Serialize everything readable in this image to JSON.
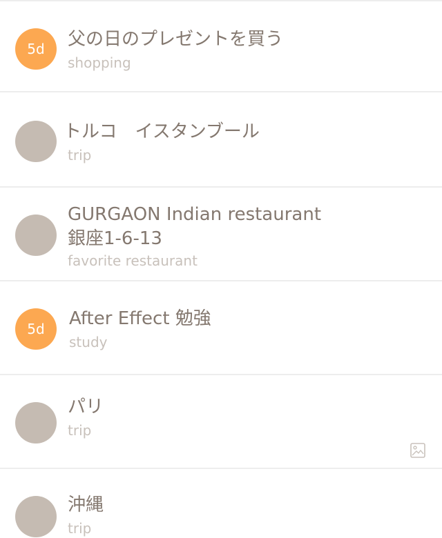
{
  "items": [
    {
      "badge": "5d",
      "title": "父の日のプレゼントを買う",
      "subtitle": "shopping"
    },
    {
      "badge": "",
      "title": "トルコ　イスタンブール",
      "subtitle": "trip"
    },
    {
      "badge": "",
      "title": "GURGAON Indian restaurant",
      "title_line2": "銀座1-6-13",
      "subtitle": "favorite restaurant"
    },
    {
      "badge": "5d",
      "title": "After Effect 勉強",
      "subtitle": "study"
    },
    {
      "badge": "",
      "title": "パリ",
      "subtitle": "trip",
      "attachment_icon": "image-icon"
    },
    {
      "badge": "",
      "title": "沖縄",
      "subtitle": "trip"
    }
  ],
  "colors": {
    "accent_badge": "#fca851",
    "neutral_badge": "#c5bbb2",
    "title_text": "#84786f",
    "subtitle_text": "#c8c1bb",
    "divider": "#ededed"
  }
}
